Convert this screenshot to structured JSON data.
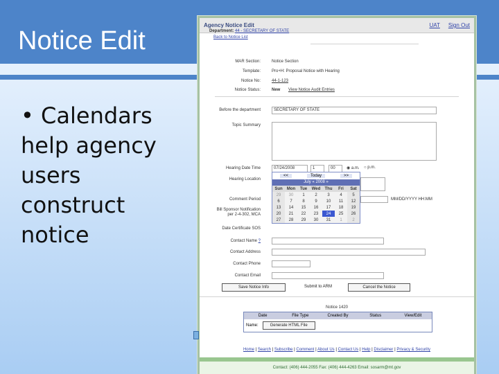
{
  "slide": {
    "title": "Notice Edit",
    "bullet_lines": [
      "• Calendars",
      "help agency",
      "users",
      "construct",
      "notice"
    ]
  },
  "app": {
    "title": "Agency Notice Edit",
    "header_links": [
      "UAT",
      "Sign Out"
    ],
    "department_label": "Department:",
    "department_value": "44 - SECRETARY OF STATE",
    "back_link": "Back to Notice List"
  },
  "form": {
    "mar_section_label": "MAR Section:",
    "mar_section_value": "Notice Section",
    "template_label": "Template:",
    "template_value": "Pro+H: Proposal Notice with Hearing",
    "notice_no_label": "Notice No:",
    "notice_no_value": "44-1-123",
    "notice_status_label": "Notice Status:",
    "notice_status_value": "New",
    "audit_link": "View Notice Audit Entries",
    "before_dept_label": "Before the department",
    "before_dept_value": "SECRETARY OF STATE",
    "topic_summary_label": "Topic Summary",
    "hearing_dt_label": "Hearing Date Time",
    "hearing_date_value": "07/24/2008",
    "hour_value": "1",
    "minute_value": "00",
    "am_label": "a.m.",
    "pm_label": "p.m.",
    "hearing_location_label": "Hearing Location",
    "comment_period_label": "Comment Period",
    "date_format_hint": "MM/DD/YYYY HH:MM",
    "bill_sponsor_label_1": "Bill Sponsor Notification",
    "bill_sponsor_label_2": "per 2-4-302, MCA",
    "date_certificate_label": "Date Certificate SOS",
    "contact_name_label": "Contact Name",
    "contact_name_help": "?",
    "contact_address_label": "Contact Address",
    "contact_phone_label": "Contact Phone",
    "contact_email_label": "Contact Email"
  },
  "buttons": {
    "save": "Save Notice Info",
    "submit": "Submit to ARM",
    "cancel": "Cancel the Notice"
  },
  "calendar": {
    "prev": "<<",
    "today": "Today",
    "next": ">>",
    "month_label": "July « 2008 »",
    "weekdays": [
      "Sun",
      "Mon",
      "Tue",
      "Wed",
      "Thu",
      "Fri",
      "Sat"
    ],
    "weeks": [
      [
        "29",
        "30",
        "1",
        "2",
        "3",
        "4",
        "5"
      ],
      [
        "6",
        "7",
        "8",
        "9",
        "10",
        "11",
        "12"
      ],
      [
        "13",
        "14",
        "15",
        "16",
        "17",
        "18",
        "19"
      ],
      [
        "20",
        "21",
        "22",
        "23",
        "24",
        "25",
        "26"
      ],
      [
        "27",
        "28",
        "29",
        "30",
        "31",
        "1",
        "2"
      ]
    ],
    "selected": "24"
  },
  "files": {
    "notice_label": "Notice 1420",
    "columns": [
      "Date",
      "File Type",
      "Created By",
      "Status",
      "View/Edit"
    ],
    "name_label": "Name:",
    "generate_button": "Generate HTML File"
  },
  "footer": {
    "links": [
      "Home",
      "Search",
      "Subscribe",
      "Comment",
      "About Us",
      "Contact Us",
      "Help",
      "Disclaimer",
      "Privacy & Security"
    ],
    "contact": "Contact: (406) 444-2055   Fax: (406) 444-4263   Email: sosarm@mt.gov"
  }
}
